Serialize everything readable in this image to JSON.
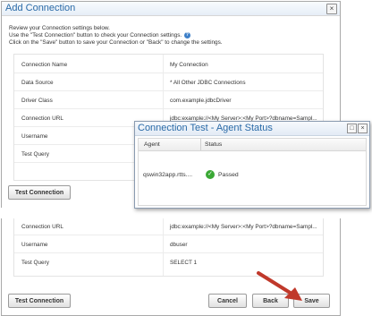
{
  "dialog": {
    "title": "Add Connection",
    "close_glyph": "×",
    "instructions": [
      "Review your Connection settings below.",
      "Use the \"Test Connection\" button to check your Connection settings.",
      "Click on the \"Save\" button to save your Connection or \"Back\" to change the settings."
    ],
    "help_glyph": "?",
    "fields": [
      {
        "label": "Connection Name",
        "value": "My Connection"
      },
      {
        "label": "Data Source",
        "value": "* All Other JDBC Connections"
      },
      {
        "label": "Driver Class",
        "value": "com.example.jdbcDriver"
      },
      {
        "label": "Connection URL",
        "value": "jdbc:example://<My Server>:<My Port>?dbname=Sampl..."
      },
      {
        "label": "Username",
        "value": ""
      },
      {
        "label": "Test Query",
        "value": ""
      }
    ],
    "fields_bottom": [
      {
        "label": "Connection URL",
        "value": "jdbc:example://<My Server>:<My Port>?dbname=Sampl..."
      },
      {
        "label": "Username",
        "value": "dbuser"
      },
      {
        "label": "Test Query",
        "value": "SELECT 1"
      }
    ],
    "buttons": {
      "test_connection": "Test Connection",
      "cancel": "Cancel",
      "back": "Back",
      "save": "Save"
    }
  },
  "test_dialog": {
    "title": "Connection Test - Agent Status",
    "maximize_glyph": "□",
    "close_glyph": "×",
    "columns": [
      "Agent",
      "Status"
    ],
    "rows": [
      {
        "agent": "qswin32app.rtts....",
        "status": "Passed",
        "status_icon": "check-circle-icon"
      }
    ]
  },
  "colors": {
    "title_blue": "#2a6aa7",
    "arrow_red": "#c0392b",
    "passed_green": "#3aa835"
  }
}
